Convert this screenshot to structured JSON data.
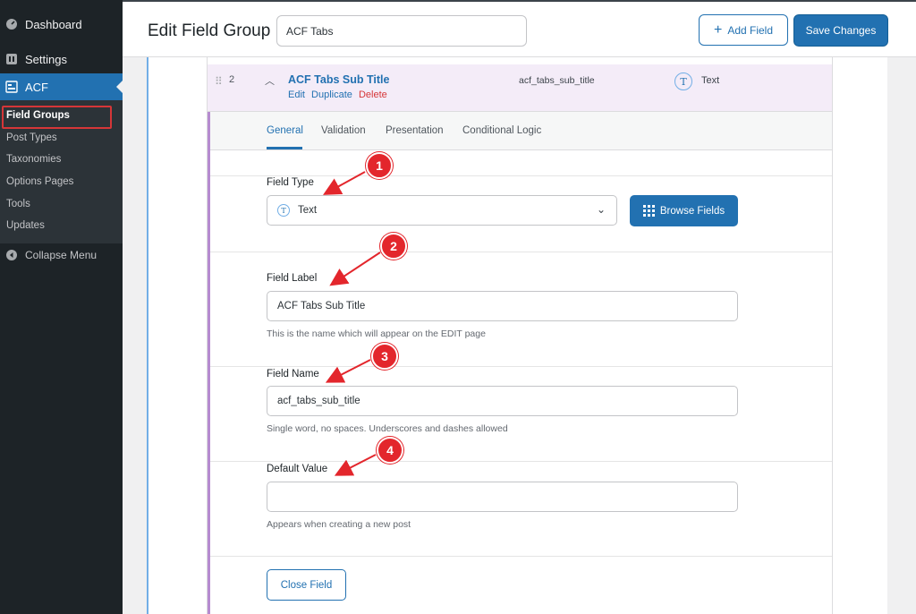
{
  "sidebar": {
    "dashboard": "Dashboard",
    "settings": "Settings",
    "acf": "ACF",
    "submenu": [
      "Field Groups",
      "Post Types",
      "Taxonomies",
      "Options Pages",
      "Tools",
      "Updates"
    ],
    "collapse": "Collapse Menu"
  },
  "header": {
    "title": "Edit Field Group",
    "group_name": "ACF Tabs",
    "add_field": "Add Field",
    "save": "Save Changes"
  },
  "field": {
    "order": "2",
    "label": "ACF Tabs Sub Title",
    "actions": {
      "edit": "Edit",
      "duplicate": "Duplicate",
      "delete": "Delete"
    },
    "name": "acf_tabs_sub_title",
    "type": "Text"
  },
  "tabs": [
    "General",
    "Validation",
    "Presentation",
    "Conditional Logic"
  ],
  "form": {
    "field_type_label": "Field Type",
    "field_type_value": "Text",
    "browse": "Browse Fields",
    "field_label_label": "Field Label",
    "field_label_value": "ACF Tabs Sub Title",
    "field_label_help": "This is the name which will appear on the EDIT page",
    "field_name_label": "Field Name",
    "field_name_value": "acf_tabs_sub_title",
    "field_name_help": "Single word, no spaces. Underscores and dashes allowed",
    "default_label": "Default Value",
    "default_value": "",
    "default_help": "Appears when creating a new post",
    "close": "Close Field"
  },
  "annotations": [
    "1",
    "2",
    "3",
    "4"
  ],
  "colors": {
    "accent": "#2271b1",
    "annotation": "#e3262c",
    "sidebar": "#1d2327"
  }
}
